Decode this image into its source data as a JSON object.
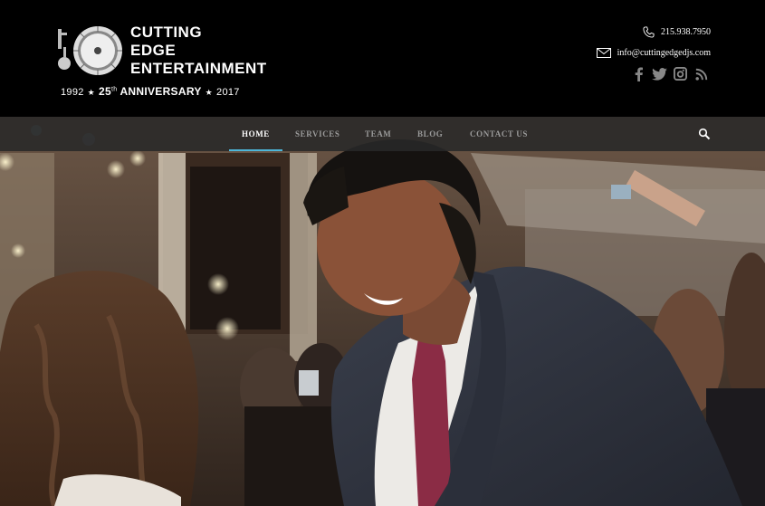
{
  "logo": {
    "line1": "CUTTING",
    "line2": "EDGE",
    "line3": "ENTERTAINMENT",
    "year_start": "1992",
    "anniversary_num": "25",
    "anniversary_sup": "th",
    "anniversary_word": "ANNIVERSARY",
    "year_end": "2017"
  },
  "contact": {
    "phone": "215.938.7950",
    "email": "info@cuttingedgedjs.com"
  },
  "social": [
    "facebook-icon",
    "twitter-icon",
    "instagram-icon",
    "rss-icon"
  ],
  "nav": {
    "items": [
      {
        "label": "HOME",
        "active": true
      },
      {
        "label": "SERVICES",
        "active": false
      },
      {
        "label": "TEAM",
        "active": false
      },
      {
        "label": "BLOG",
        "active": false
      },
      {
        "label": "CONTACT US",
        "active": false
      }
    ]
  },
  "colors": {
    "accent": "#4db6d8",
    "header_bg": "#000000",
    "nav_bg": "#282828"
  }
}
